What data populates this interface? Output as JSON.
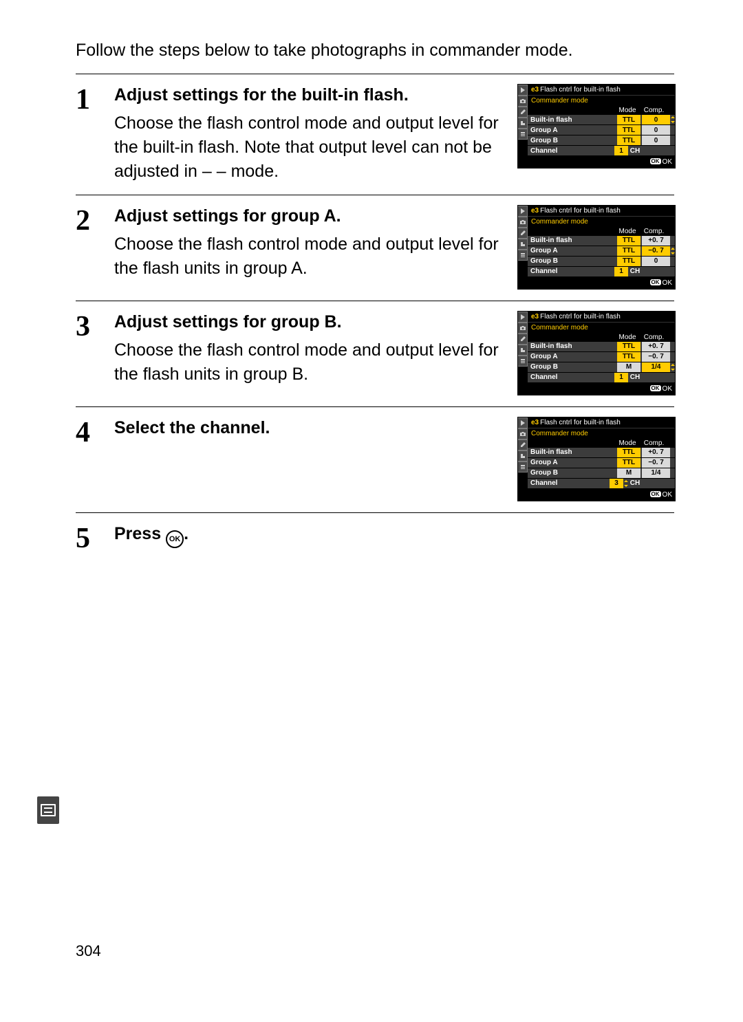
{
  "intro": "Follow the steps below to take photographs in commander mode.",
  "page_number": "304",
  "lcd_common": {
    "e3_label": "e3",
    "e3_title": "Flash cntrl for built-in flash",
    "subtitle": "Commander mode",
    "col_mode": "Mode",
    "col_comp": "Comp.",
    "foot_ok_box": "OK",
    "foot_ok": "OK"
  },
  "steps": [
    {
      "num": "1",
      "title": "Adjust settings for the built-in flash.",
      "para": "Choose the flash control mode and output level for the built-in flash. Note that output level can not be adjusted in – – mode.",
      "lcd": {
        "rows": [
          {
            "label": "Built-in flash",
            "mode": "TTL",
            "mode_hi": true,
            "comp": "0",
            "comp_hi": true,
            "spinner": true
          },
          {
            "label": "Group A",
            "mode": "TTL",
            "mode_hi": true,
            "comp": "0",
            "comp_hi": false
          },
          {
            "label": "Group B",
            "mode": "TTL",
            "mode_hi": true,
            "comp": "0",
            "comp_hi": false
          },
          {
            "label": "Channel",
            "ch": "1",
            "ch_hi": true,
            "ch_extra": "CH"
          }
        ]
      }
    },
    {
      "num": "2",
      "title": "Adjust settings for group A.",
      "para": "Choose the flash control mode and output level for the flash units in group A.",
      "lcd": {
        "rows": [
          {
            "label": "Built-in flash",
            "mode": "TTL",
            "mode_hi": true,
            "comp": "+0. 7",
            "comp_hi": false
          },
          {
            "label": "Group A",
            "mode": "TTL",
            "mode_hi": true,
            "comp": "−0. 7",
            "comp_hi": true,
            "spinner": true
          },
          {
            "label": "Group B",
            "mode": "TTL",
            "mode_hi": true,
            "comp": "0",
            "comp_hi": false
          },
          {
            "label": "Channel",
            "ch": "1",
            "ch_hi": true,
            "ch_extra": "CH"
          }
        ]
      }
    },
    {
      "num": "3",
      "title": "Adjust settings for group B.",
      "para": "Choose the flash control mode and output level for the flash units in group B.",
      "lcd": {
        "rows": [
          {
            "label": "Built-in flash",
            "mode": "TTL",
            "mode_hi": true,
            "comp": "+0. 7",
            "comp_hi": false
          },
          {
            "label": "Group A",
            "mode": "TTL",
            "mode_hi": true,
            "comp": "−0. 7",
            "comp_hi": false
          },
          {
            "label": "Group B",
            "mode": "M",
            "mode_hi": false,
            "comp": "1/4",
            "comp_hi": true,
            "spinner": true
          },
          {
            "label": "Channel",
            "ch": "1",
            "ch_hi": true,
            "ch_extra": "CH"
          }
        ]
      }
    },
    {
      "num": "4",
      "title": "Select the channel.",
      "para": "",
      "lcd": {
        "rows": [
          {
            "label": "Built-in flash",
            "mode": "TTL",
            "mode_hi": true,
            "comp": "+0. 7",
            "comp_hi": false
          },
          {
            "label": "Group A",
            "mode": "TTL",
            "mode_hi": true,
            "comp": "−0. 7",
            "comp_hi": false
          },
          {
            "label": "Group B",
            "mode": "M",
            "mode_hi": false,
            "comp": "1/4",
            "comp_hi": false
          },
          {
            "label": "Channel",
            "ch": "3",
            "ch_hi": true,
            "ch_extra": "CH",
            "spinner": true
          }
        ]
      }
    },
    {
      "num": "5",
      "title_prefix": "Press ",
      "title_suffix": "."
    }
  ]
}
